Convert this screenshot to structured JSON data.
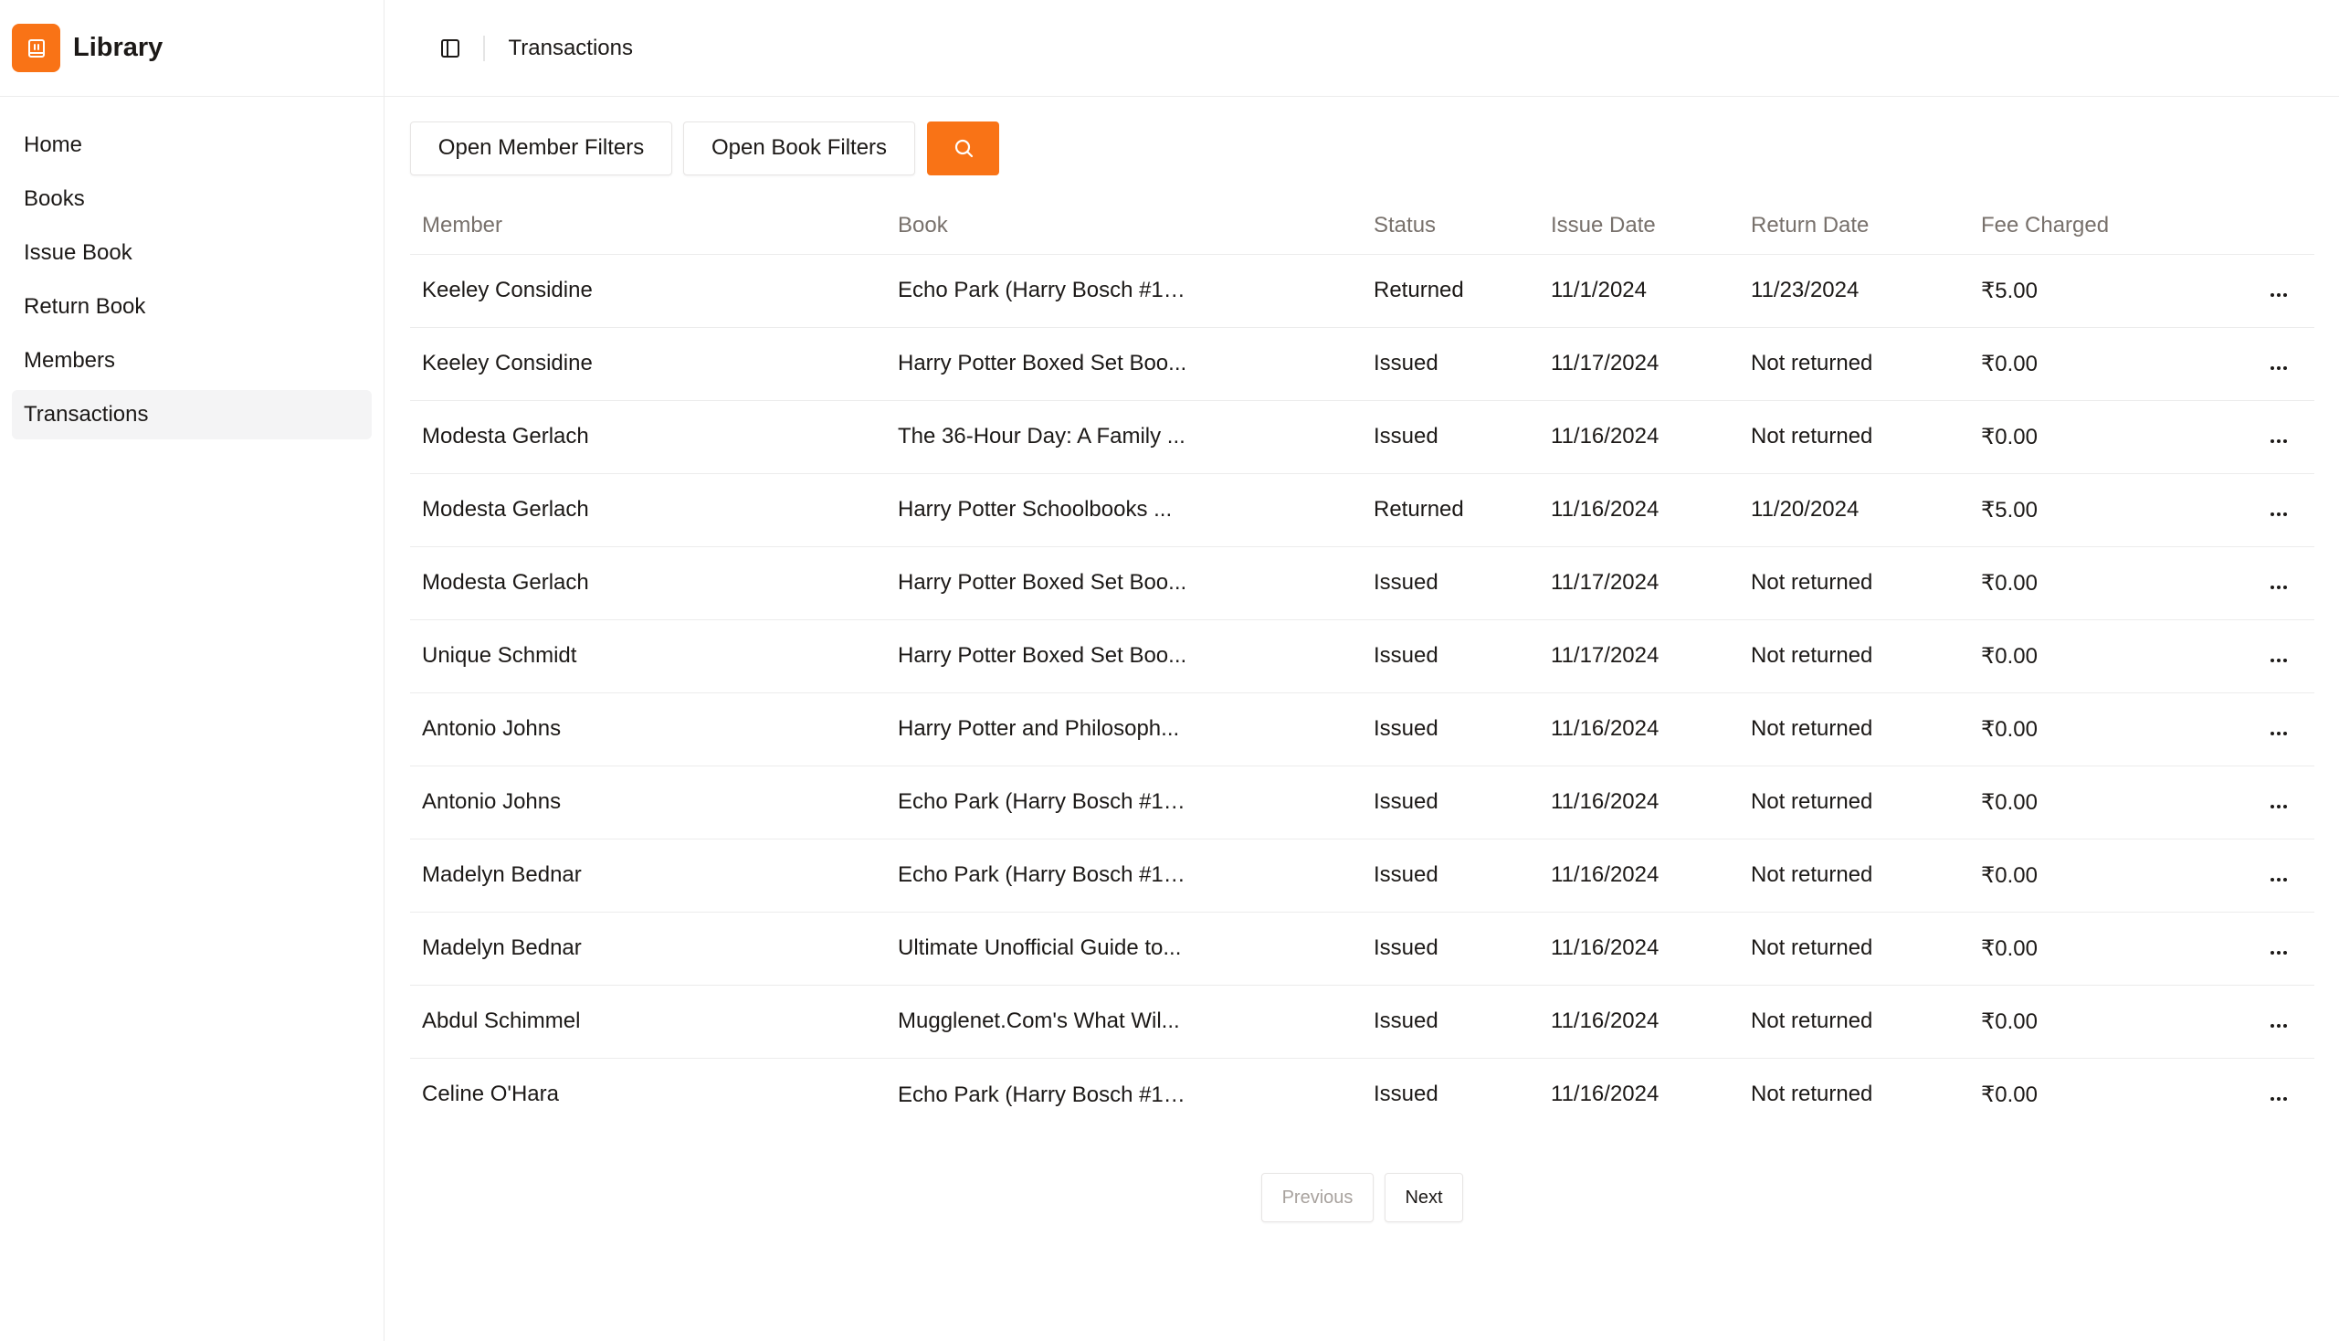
{
  "brand": {
    "name": "Library",
    "accent": "#f97316"
  },
  "sidebar": {
    "items": [
      {
        "label": "Home"
      },
      {
        "label": "Books"
      },
      {
        "label": "Issue Book"
      },
      {
        "label": "Return Book"
      },
      {
        "label": "Members"
      },
      {
        "label": "Transactions",
        "active": true
      }
    ]
  },
  "header": {
    "title": "Transactions"
  },
  "filters": {
    "member_label": "Open Member Filters",
    "book_label": "Open Book Filters",
    "search_icon": "search-icon"
  },
  "table": {
    "columns": [
      "Member",
      "Book",
      "Status",
      "Issue Date",
      "Return Date",
      "Fee Charged",
      ""
    ],
    "rows": [
      [
        "Keeley Considine",
        "Echo Park (Harry Bosch #12...",
        "Returned",
        "11/1/2024",
        "11/23/2024",
        "₹5.00"
      ],
      [
        "Keeley Considine",
        "Harry Potter Boxed Set Boo...",
        "Issued",
        "11/17/2024",
        "Not returned",
        "₹0.00"
      ],
      [
        "Modesta Gerlach",
        "The 36-Hour Day: A Family ...",
        "Issued",
        "11/16/2024",
        "Not returned",
        "₹0.00"
      ],
      [
        "Modesta Gerlach",
        "Harry Potter Schoolbooks ...",
        "Returned",
        "11/16/2024",
        "11/20/2024",
        "₹5.00"
      ],
      [
        "Modesta Gerlach",
        "Harry Potter Boxed Set Boo...",
        "Issued",
        "11/17/2024",
        "Not returned",
        "₹0.00"
      ],
      [
        "Unique Schmidt",
        "Harry Potter Boxed Set Boo...",
        "Issued",
        "11/17/2024",
        "Not returned",
        "₹0.00"
      ],
      [
        "Antonio Johns",
        "Harry Potter and Philosoph...",
        "Issued",
        "11/16/2024",
        "Not returned",
        "₹0.00"
      ],
      [
        "Antonio Johns",
        "Echo Park (Harry Bosch #12...",
        "Issued",
        "11/16/2024",
        "Not returned",
        "₹0.00"
      ],
      [
        "Madelyn Bednar",
        "Echo Park (Harry Bosch #12...",
        "Issued",
        "11/16/2024",
        "Not returned",
        "₹0.00"
      ],
      [
        "Madelyn Bednar",
        "Ultimate Unofficial Guide to...",
        "Issued",
        "11/16/2024",
        "Not returned",
        "₹0.00"
      ],
      [
        "Abdul Schimmel",
        "Mugglenet.Com's What Wil...",
        "Issued",
        "11/16/2024",
        "Not returned",
        "₹0.00"
      ],
      [
        "Celine O'Hara",
        "Echo Park (Harry Bosch #12...",
        "Issued",
        "11/16/2024",
        "Not returned",
        "₹0.00"
      ]
    ]
  },
  "pagination": {
    "previous_label": "Previous",
    "next_label": "Next"
  }
}
